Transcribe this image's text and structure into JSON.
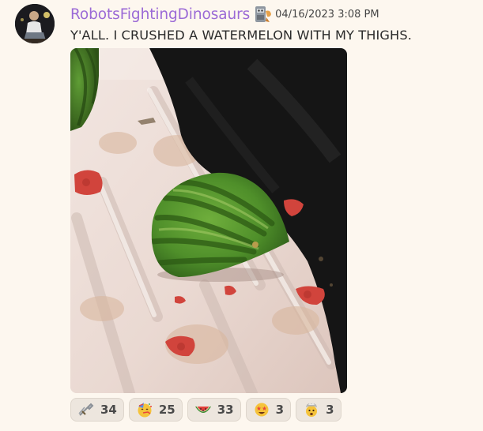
{
  "message": {
    "author": "RobotsFightingDinosaurs",
    "timestamp": "04/16/2023 3:08 PM",
    "content": "Y'ALL. I CRUSHED A WATERMELON WITH MY THIGHS.",
    "author_color": "#9b6ad6",
    "badge_icon": "robot-dinosaur-badge-icon",
    "attachment": {
      "type": "image",
      "subject": "crushed watermelon on a bathtub mat"
    }
  },
  "reactions": [
    {
      "emoji": "sword-cross-icon",
      "count": "34"
    },
    {
      "emoji": "partying-face-icon",
      "count": "25"
    },
    {
      "emoji": "watermelon-icon",
      "count": "33"
    },
    {
      "emoji": "star-struck-icon",
      "count": "3"
    },
    {
      "emoji": "exploding-head-icon",
      "count": "3"
    }
  ]
}
